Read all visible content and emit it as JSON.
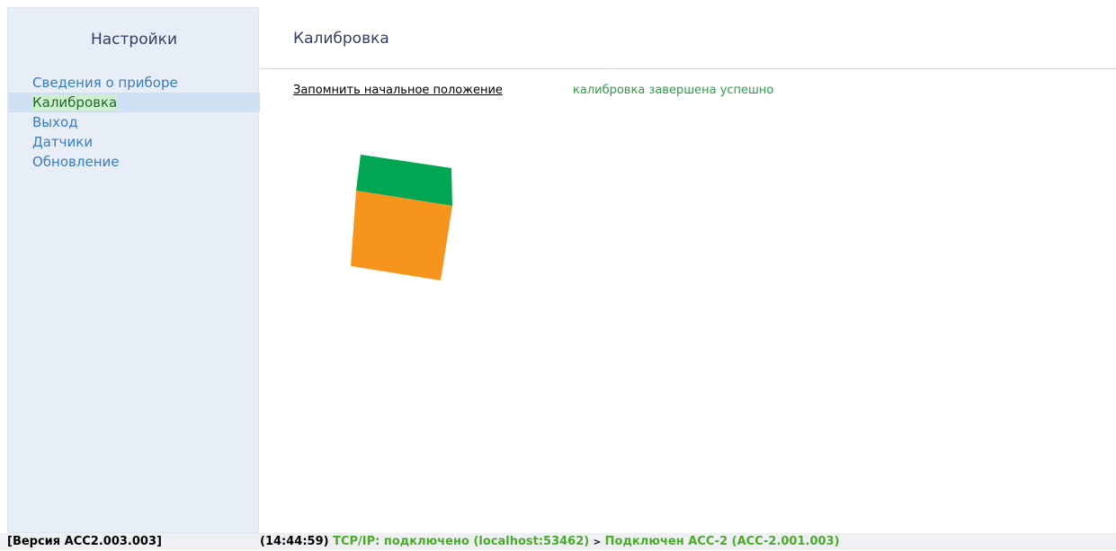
{
  "sidebar": {
    "title": "Настройки",
    "items": [
      {
        "label": "Сведения о приборе",
        "active": false
      },
      {
        "label": "Калибровка",
        "active": true
      },
      {
        "label": "Выход",
        "active": false
      },
      {
        "label": "Датчики",
        "active": false
      },
      {
        "label": "Обновление",
        "active": false
      }
    ]
  },
  "main": {
    "title": "Калибровка",
    "remember_link": "Запомнить начальное положение",
    "status_message": "калибровка завершена успешно",
    "cube": {
      "top_color": "#00a651",
      "front_color": "#f7941d"
    }
  },
  "statusbar": {
    "version": "[Версия ACC2.003.003]",
    "time": "(14:44:59)",
    "tcp_status": "TCP/IP: подключено (localhost:53462)",
    "separator": ">",
    "device_status": "Подключен ACC-2 (ACC-2.001.003)"
  },
  "colors": {
    "sidebar_bg": "#e8eef7",
    "link_blue": "#3a7bc1",
    "success_green": "#2aa043",
    "status_green": "#4aab2a"
  }
}
